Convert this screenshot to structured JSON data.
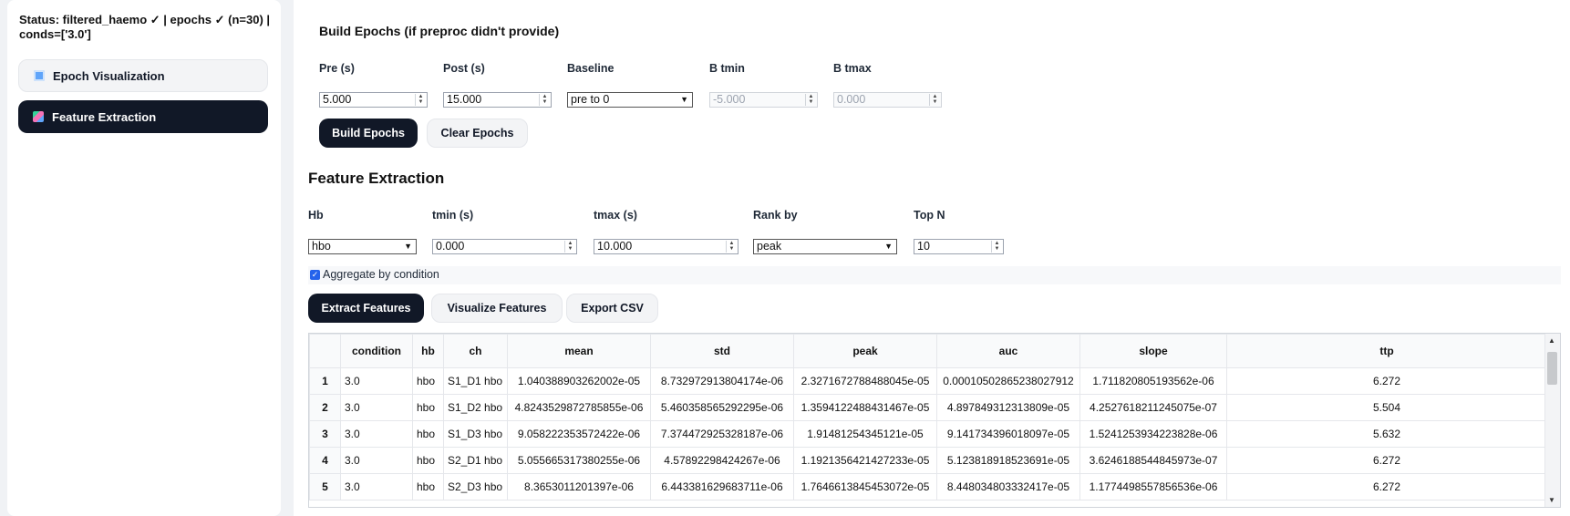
{
  "sidebar": {
    "status": "Status: filtered_haemo ✓ | epochs ✓ (n=30) | conds=['3.0']",
    "nav": [
      {
        "label": "Epoch Visualization",
        "icon": "grid-chart-icon",
        "active": false
      },
      {
        "label": "Feature Extraction",
        "icon": "color-blocks-icon",
        "active": true
      }
    ]
  },
  "build_epochs": {
    "title": "Build Epochs (if preproc didn't provide)",
    "pre_label": "Pre (s)",
    "pre_value": "5.000",
    "post_label": "Post (s)",
    "post_value": "15.000",
    "baseline_label": "Baseline",
    "baseline_value": "pre to 0",
    "btmin_label": "B tmin",
    "btmin_value": "-5.000",
    "btmax_label": "B tmax",
    "btmax_value": "0.000",
    "build_button": "Build Epochs",
    "clear_button": "Clear Epochs"
  },
  "feature_extraction": {
    "title": "Feature Extraction",
    "hb_label": "Hb",
    "hb_value": "hbo",
    "tmin_label": "tmin (s)",
    "tmin_value": "0.000",
    "tmax_label": "tmax (s)",
    "tmax_value": "10.000",
    "rank_label": "Rank by",
    "rank_value": "peak",
    "topn_label": "Top N",
    "topn_value": "10",
    "aggregate_label": "Aggregate by condition",
    "aggregate_checked": true,
    "extract_button": "Extract Features",
    "visualize_button": "Visualize Features",
    "export_button": "Export CSV"
  },
  "table": {
    "columns": [
      "condition",
      "hb",
      "ch",
      "mean",
      "std",
      "peak",
      "auc",
      "slope",
      "ttp"
    ],
    "rows": [
      [
        "1",
        "3.0",
        "hbo",
        "S1_D1 hbo",
        "1.040388903262002e-05",
        "8.732972913804174e-06",
        "2.3271672788488045e-05",
        "0.00010502865238027912",
        "1.711820805193562e-06",
        "6.272"
      ],
      [
        "2",
        "3.0",
        "hbo",
        "S1_D2 hbo",
        "4.8243529872785855e-06",
        "5.460358565292295e-06",
        "1.3594122488431467e-05",
        "4.897849312313809e-05",
        "4.2527618211245075e-07",
        "5.504"
      ],
      [
        "3",
        "3.0",
        "hbo",
        "S1_D3 hbo",
        "9.058222353572422e-06",
        "7.374472925328187e-06",
        "1.91481254345121e-05",
        "9.141734396018097e-05",
        "1.5241253934223828e-06",
        "5.632"
      ],
      [
        "4",
        "3.0",
        "hbo",
        "S2_D1 hbo",
        "5.055665317380255e-06",
        "4.57892298424267e-06",
        "1.1921356421427233e-05",
        "5.123818918523691e-05",
        "3.6246188544845973e-07",
        "6.272"
      ],
      [
        "5",
        "3.0",
        "hbo",
        "S2_D3 hbo",
        "8.3653011201397e-06",
        "6.443381629683711e-06",
        "1.7646613845453072e-05",
        "8.448034803332417e-05",
        "1.1774498557856536e-06",
        "6.272"
      ]
    ]
  }
}
